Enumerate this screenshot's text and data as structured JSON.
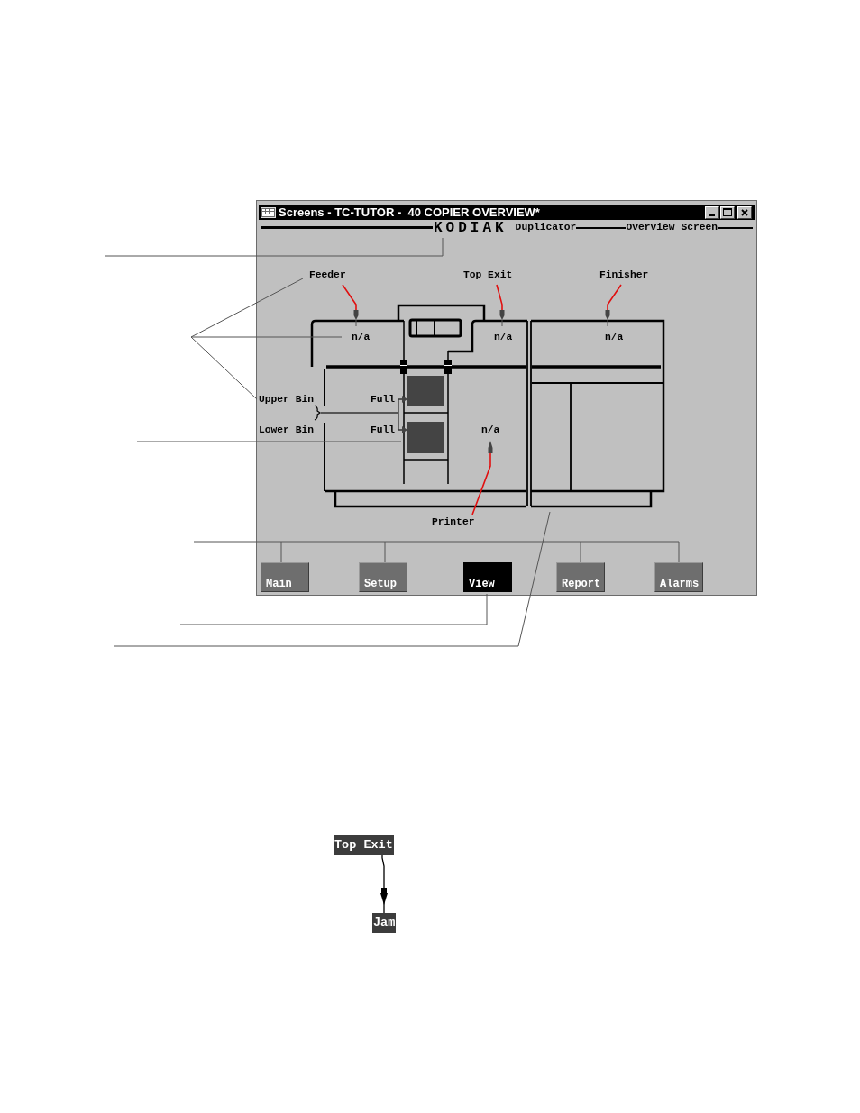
{
  "window": {
    "title": "Screens - TC-TUTOR -  40 COPIER OVERVIEW*",
    "header": {
      "brand": "KODIAK",
      "product": "Duplicator",
      "screen": "Overview Screen"
    }
  },
  "diagram": {
    "modules": [
      {
        "name": "Feeder",
        "status": "n/a"
      },
      {
        "name": "Top Exit",
        "status": "n/a"
      },
      {
        "name": "Finisher",
        "status": "n/a"
      },
      {
        "name": "Printer",
        "status": "n/a"
      }
    ],
    "bins": [
      {
        "name": "Upper Bin",
        "status": "Full"
      },
      {
        "name": "Lower Bin",
        "status": "Full"
      }
    ]
  },
  "nav_buttons": [
    {
      "label": "Main",
      "selected": false
    },
    {
      "label": "Setup",
      "selected": false
    },
    {
      "label": "View",
      "selected": true
    },
    {
      "label": "Report",
      "selected": false
    },
    {
      "label": "Alarms",
      "selected": false
    }
  ],
  "status_example": {
    "label": "Top Exit",
    "status": "Jam"
  }
}
